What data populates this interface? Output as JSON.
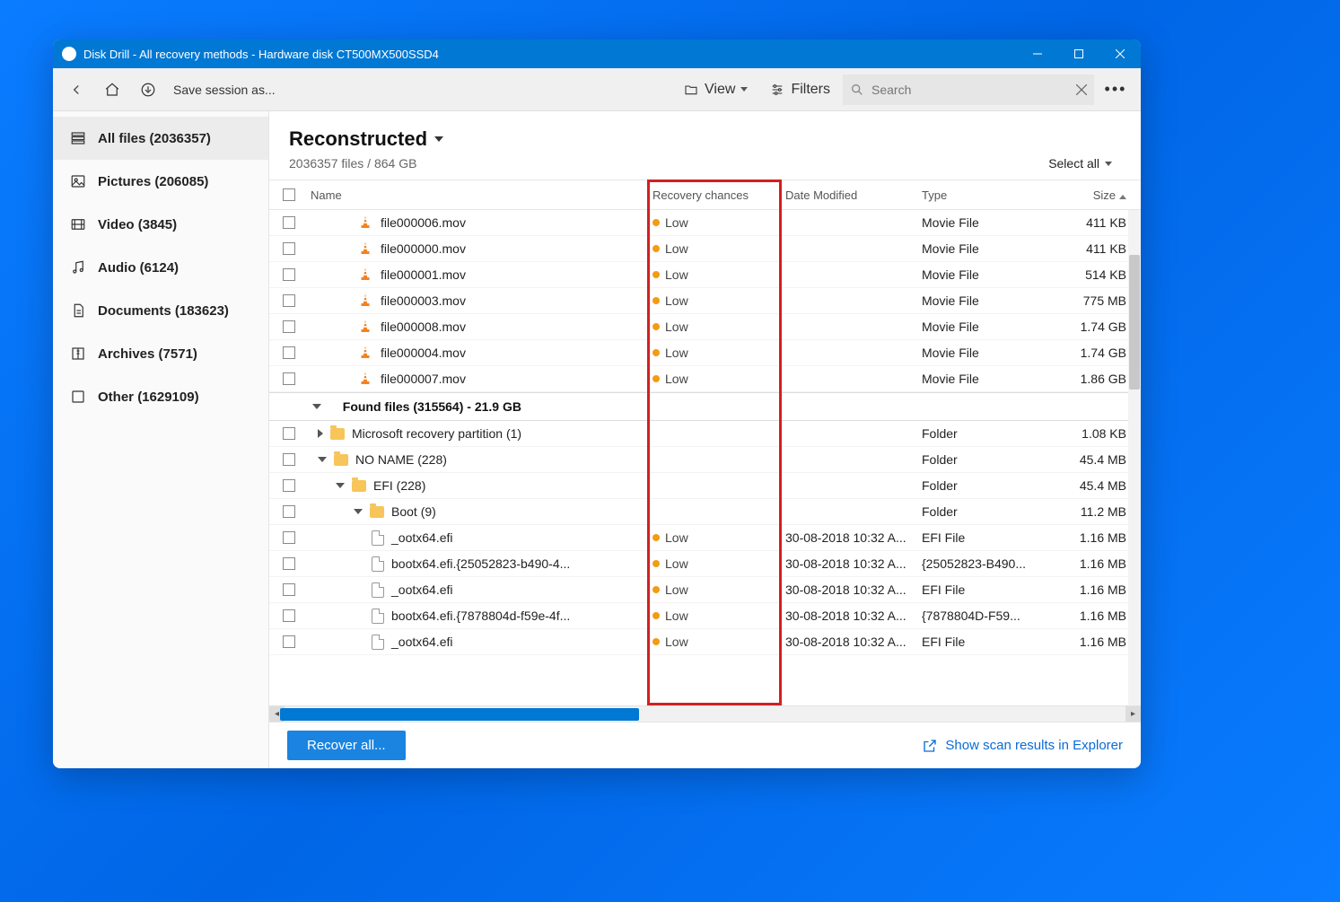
{
  "window": {
    "title": "Disk Drill - All recovery methods - Hardware disk CT500MX500SSD4"
  },
  "toolbar": {
    "save_session": "Save session as...",
    "view_label": "View",
    "filters_label": "Filters",
    "search_placeholder": "Search"
  },
  "sidebar": {
    "items": [
      {
        "label": "All files",
        "count": "(2036357)",
        "active": true
      },
      {
        "label": "Pictures",
        "count": "(206085)"
      },
      {
        "label": "Video",
        "count": "(3845)"
      },
      {
        "label": "Audio",
        "count": "(6124)"
      },
      {
        "label": "Documents",
        "count": "(183623)"
      },
      {
        "label": "Archives",
        "count": "(7571)"
      },
      {
        "label": "Other",
        "count": "(1629109)"
      }
    ]
  },
  "header": {
    "title": "Reconstructed",
    "subtitle": "2036357 files / 864 GB",
    "select_all": "Select all"
  },
  "columns": {
    "name": "Name",
    "recovery": "Recovery chances",
    "date": "Date Modified",
    "type": "Type",
    "size": "Size"
  },
  "rows": [
    {
      "kind": "file",
      "icon": "vlc",
      "indent": "indent-1",
      "name": "file000006.mov",
      "rec": "Low",
      "date": "",
      "type": "Movie File",
      "size": "411 KB"
    },
    {
      "kind": "file",
      "icon": "vlc",
      "indent": "indent-1",
      "name": "file000000.mov",
      "rec": "Low",
      "date": "",
      "type": "Movie File",
      "size": "411 KB"
    },
    {
      "kind": "file",
      "icon": "vlc",
      "indent": "indent-1",
      "name": "file000001.mov",
      "rec": "Low",
      "date": "",
      "type": "Movie File",
      "size": "514 KB"
    },
    {
      "kind": "file",
      "icon": "vlc",
      "indent": "indent-1",
      "name": "file000003.mov",
      "rec": "Low",
      "date": "",
      "type": "Movie File",
      "size": "775 MB"
    },
    {
      "kind": "file",
      "icon": "vlc",
      "indent": "indent-1",
      "name": "file000008.mov",
      "rec": "Low",
      "date": "",
      "type": "Movie File",
      "size": "1.74 GB"
    },
    {
      "kind": "file",
      "icon": "vlc",
      "indent": "indent-1",
      "name": "file000004.mov",
      "rec": "Low",
      "date": "",
      "type": "Movie File",
      "size": "1.74 GB"
    },
    {
      "kind": "file",
      "icon": "vlc",
      "indent": "indent-1",
      "name": "file000007.mov",
      "rec": "Low",
      "date": "",
      "type": "Movie File",
      "size": "1.86 GB"
    },
    {
      "kind": "section",
      "name": "Found files (315564) - 21.9 GB"
    },
    {
      "kind": "folder",
      "tri": "right",
      "indent": "indent-l1",
      "name": "Microsoft recovery partition (1)",
      "type": "Folder",
      "size": "1.08 KB"
    },
    {
      "kind": "folder",
      "tri": "down",
      "indent": "indent-l1",
      "name": "NO NAME (228)",
      "type": "Folder",
      "size": "45.4 MB"
    },
    {
      "kind": "folder",
      "tri": "down",
      "indent": "indent-l2",
      "name": "EFI (228)",
      "type": "Folder",
      "size": "45.4 MB"
    },
    {
      "kind": "folder",
      "tri": "down",
      "indent": "indent-l3",
      "name": "Boot (9)",
      "type": "Folder",
      "size": "11.2 MB"
    },
    {
      "kind": "file",
      "icon": "doc",
      "indent": "indent-l4",
      "name": "_ootx64.efi",
      "rec": "Low",
      "date": "30-08-2018 10:32 A...",
      "type": "EFI File",
      "size": "1.16 MB"
    },
    {
      "kind": "file",
      "icon": "doc",
      "indent": "indent-l4",
      "name": "bootx64.efi.{25052823-b490-4...",
      "rec": "Low",
      "date": "30-08-2018 10:32 A...",
      "type": "{25052823-B490...",
      "size": "1.16 MB"
    },
    {
      "kind": "file",
      "icon": "doc",
      "indent": "indent-l4",
      "name": "_ootx64.efi",
      "rec": "Low",
      "date": "30-08-2018 10:32 A...",
      "type": "EFI File",
      "size": "1.16 MB"
    },
    {
      "kind": "file",
      "icon": "doc",
      "indent": "indent-l4",
      "name": "bootx64.efi.{7878804d-f59e-4f...",
      "rec": "Low",
      "date": "30-08-2018 10:32 A...",
      "type": "{7878804D-F59...",
      "size": "1.16 MB"
    },
    {
      "kind": "file",
      "icon": "doc",
      "indent": "indent-l4",
      "name": "_ootx64.efi",
      "rec": "Low",
      "date": "30-08-2018 10:32 A...",
      "type": "EFI File",
      "size": "1.16 MB"
    }
  ],
  "footer": {
    "recover": "Recover all...",
    "explorer": "Show scan results in Explorer"
  }
}
